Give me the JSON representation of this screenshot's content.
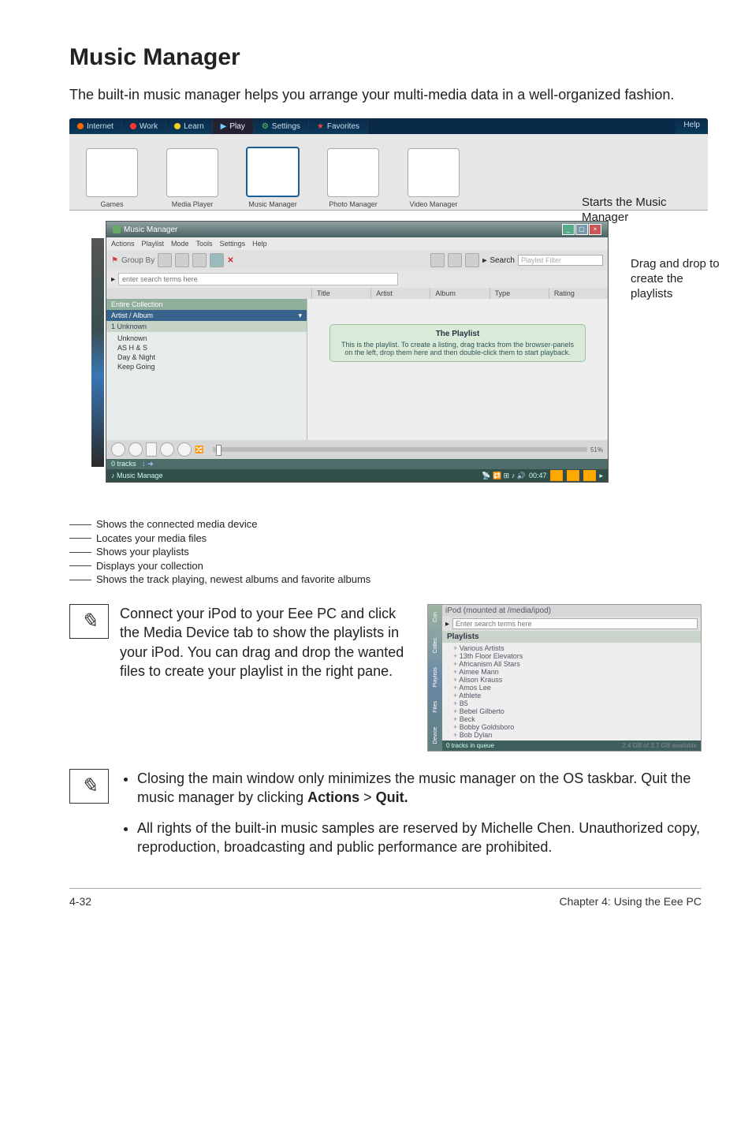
{
  "heading": "Music Manager",
  "intro": "The built-in music manager helps you arrange your multi-media data in a well-organized fashion.",
  "topbar": {
    "internet": "Internet",
    "work": "Work",
    "learn": "Learn",
    "play": "Play",
    "settings": "Settings",
    "favorites": "Favorites",
    "help": "Help"
  },
  "launcher": {
    "games": "Games",
    "media_player": "Media Player",
    "music_manager": "Music Manager",
    "photo_manager": "Photo Manager",
    "video_manager": "Video Manager"
  },
  "caption_start": "Starts the Music Manager",
  "caption_drag": "Drag and drop to create the playlists",
  "mm": {
    "title": "Music Manager",
    "menu": [
      "Actions",
      "Playlist",
      "Mode",
      "Tools",
      "Settings",
      "Help"
    ],
    "group_by": "Group By",
    "search_label": "Search",
    "search_placeholder": "Playlist Filter",
    "search2_placeholder": "enter search terms here",
    "cols": [
      "Title",
      "Artist",
      "Album",
      "Type",
      "Rating"
    ],
    "left": {
      "entire": "Entire Collection",
      "artist_album": "Artist / Album",
      "unknown": "1 Unknown",
      "items": [
        "Unknown",
        "AS H & S",
        "Day & Night",
        "Keep Going"
      ]
    },
    "tip": {
      "title": "The Playlist",
      "body": "This is the playlist. To create a listing, drag tracks from the browser-panels on the left, drop them here and then double-click them to start playback."
    },
    "tracks": "0 tracks",
    "ticker": "Music Manage",
    "time": "00:47"
  },
  "legend": [
    "Shows the connected media device",
    "Locates your media files",
    "Shows your playlists",
    "Displays your collection",
    "Shows the track playing, newest albums and favorite albums"
  ],
  "note1": "Connect your iPod to your Eee PC and click the Media Device tab to show the playlists in your iPod. You can drag and drop the wanted files to create your playlist in the right pane.",
  "ipod": {
    "header": "iPod (mounted at /media/ipod)",
    "search_placeholder": "Enter search terms here",
    "playlists_label": "Playlists",
    "items": [
      "Various Artists",
      "13th Floor Elevators",
      "Africanism All Stars",
      "Aimee Mann",
      "Alison Krauss",
      "Amos Lee",
      "Athlete",
      "B5",
      "Bebel Gilberto",
      "Beck",
      "Bobby Goldsboro",
      "Bob Dylan"
    ],
    "foot_left": "0 tracks in queue",
    "foot_right": "2.4 GB of 3.7 GB available"
  },
  "note2": "Closing the main window only minimizes the music manager on the OS taskbar. Quit the music manager by clicking ",
  "note2_bold1": "Actions",
  "note2_mid": " > ",
  "note2_bold2": "Quit.",
  "note3": "All rights of the built-in music samples are reserved by Michelle Chen. Unauthorized copy, reproduction, broadcasting and public performance are prohibited.",
  "footer_left": "4-32",
  "footer_right": "Chapter 4: Using the Eee PC"
}
